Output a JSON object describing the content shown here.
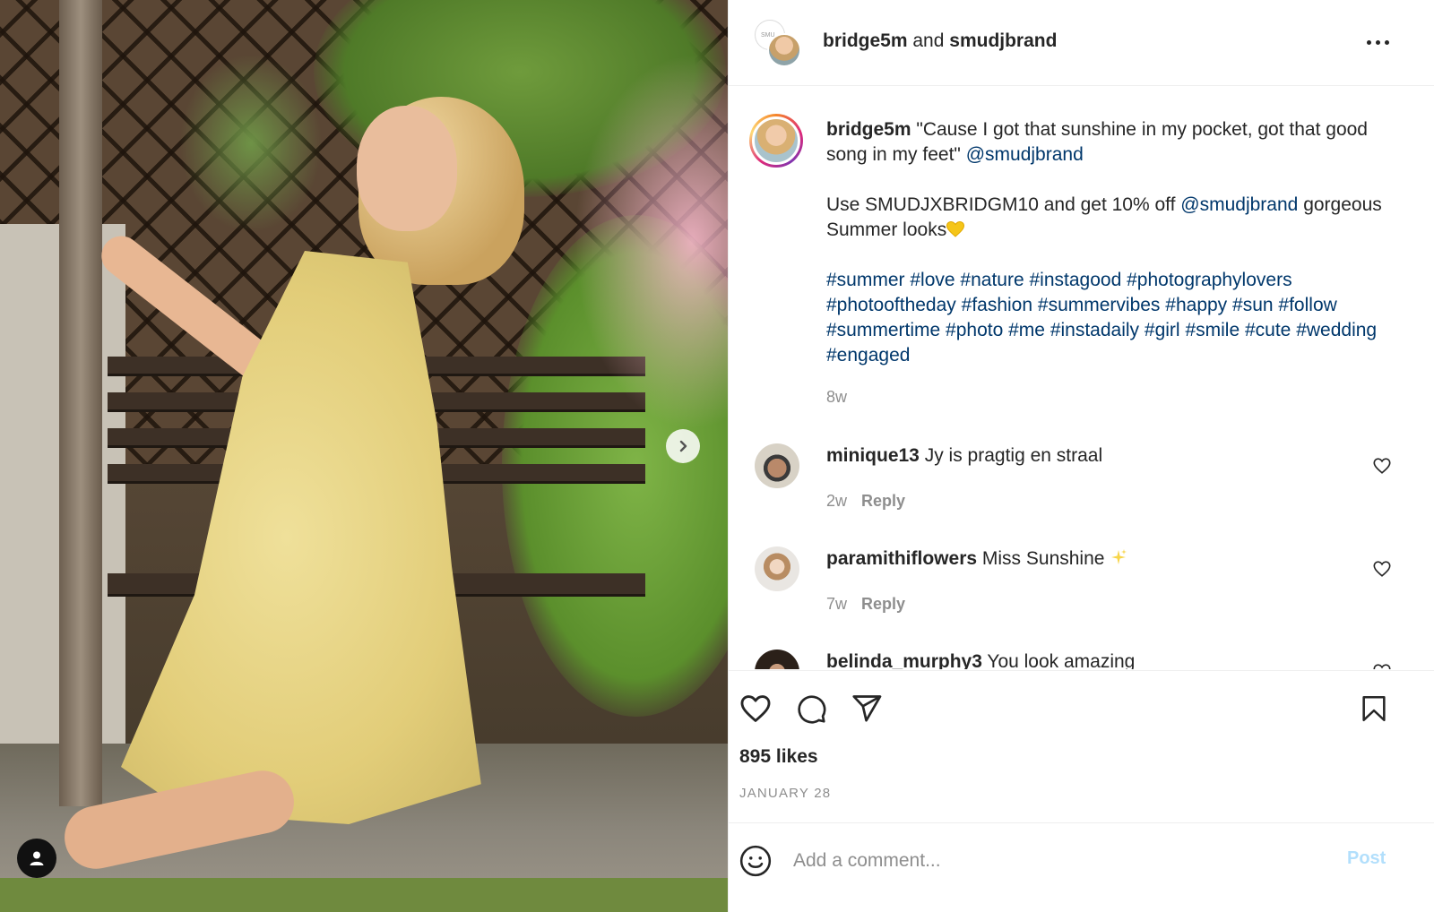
{
  "header": {
    "user1": "bridge5m",
    "connector": "and",
    "user2": "smudjbrand",
    "back_avatar_text": "SMU"
  },
  "caption": {
    "username": "bridge5m",
    "line1_text": "\"Cause I got that sunshine in my pocket, got that good song in my feet\"",
    "line1_mention": "@smudjbrand",
    "line2_text": "Use SMUDJXBRIDGM10 and get 10% off",
    "line2_mention": "@smudjbrand",
    "line2_end": "gorgeous Summer looks",
    "hashtags": [
      "#summer",
      "#love",
      "#nature",
      "#instagood",
      "#photographylovers",
      "#photooftheday",
      "#fashion",
      "#summervibes",
      "#happy",
      "#sun",
      "#follow",
      "#summertime",
      "#photo",
      "#me",
      "#instadaily",
      "#girl",
      "#smile",
      "#cute",
      "#wedding",
      "#engaged"
    ],
    "time": "8w"
  },
  "comments": [
    {
      "username": "minique13",
      "text": "Jy is pragtig en straal",
      "time": "2w",
      "reply_label": "Reply"
    },
    {
      "username": "paramithiflowers",
      "text": "Miss Sunshine",
      "time": "7w",
      "reply_label": "Reply"
    },
    {
      "username": "belinda_murphy3",
      "text": "You look amazing"
    }
  ],
  "icons": {
    "like": "heart-icon",
    "comment": "comment-bubble-icon",
    "share": "paper-plane-icon",
    "save": "bookmark-icon",
    "emoji": "smiley-icon",
    "more": "more-horizontal-icon",
    "next": "chevron-right-icon",
    "tagged": "user-icon"
  },
  "stats": {
    "likes": "895 likes",
    "date": "JANUARY 28"
  },
  "add_comment": {
    "placeholder": "Add a comment...",
    "post_label": "Post"
  },
  "colors": {
    "link": "#00376b",
    "muted": "#8e8e8e",
    "post_disabled": "#b2dffc",
    "dress": "#e2cd79"
  }
}
